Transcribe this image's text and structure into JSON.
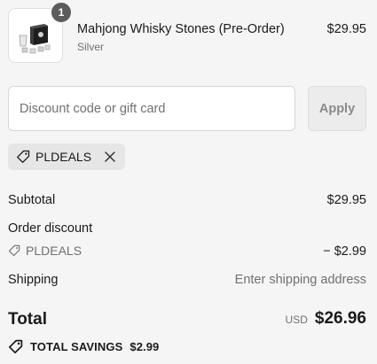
{
  "cart": {
    "item": {
      "quantity": "1",
      "name": "Mahjong Whisky Stones (Pre-Order)",
      "variant": "Silver",
      "price": "$29.95"
    }
  },
  "discount": {
    "placeholder": "Discount code or gift card",
    "value": "",
    "apply_label": "Apply",
    "applied_code": "PLDEALS"
  },
  "summary": {
    "subtotal_label": "Subtotal",
    "subtotal_value": "$29.95",
    "order_discount_label": "Order discount",
    "discount_code": "PLDEALS",
    "discount_value": "− $2.99",
    "shipping_label": "Shipping",
    "shipping_value": "Enter shipping address",
    "total_label": "Total",
    "currency": "USD",
    "total_value": "$26.96",
    "savings_label": "TOTAL SAVINGS",
    "savings_value": "$2.99"
  },
  "icons": {
    "tag": "tag-icon",
    "close": "close-icon",
    "product": "product-image"
  },
  "colors": {
    "background": "#f5f5f5",
    "badge": "#5c5c5c",
    "muted_text": "#707070",
    "apply_disabled": "#ececec"
  }
}
